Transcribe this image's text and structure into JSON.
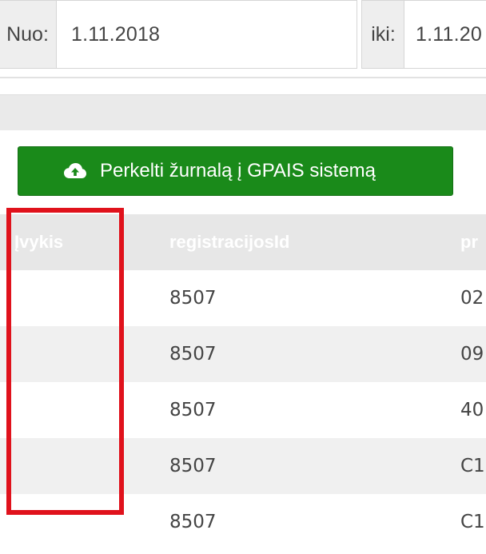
{
  "filter": {
    "from_label": "Nuo:",
    "from_value": "1.11.2018",
    "to_label": "iki:",
    "to_value": "1.11.20"
  },
  "action_button": {
    "label": "Perkelti žurnalą į GPAIS sistemą",
    "icon": "cloud-upload-icon"
  },
  "table": {
    "columns": [
      "Įvykis",
      "registracijosId",
      "pr"
    ],
    "rows": [
      [
        "",
        "8507",
        "02"
      ],
      [
        "",
        "8507",
        "09"
      ],
      [
        "",
        "8507",
        "40"
      ],
      [
        "",
        "8507",
        "C1"
      ],
      [
        "",
        "8507",
        "C1"
      ]
    ]
  },
  "colors": {
    "button": "#1a8a1a",
    "highlight": "#e0121c",
    "header_bg": "#e7e7e7",
    "row_alt": "#f0f0f0"
  }
}
